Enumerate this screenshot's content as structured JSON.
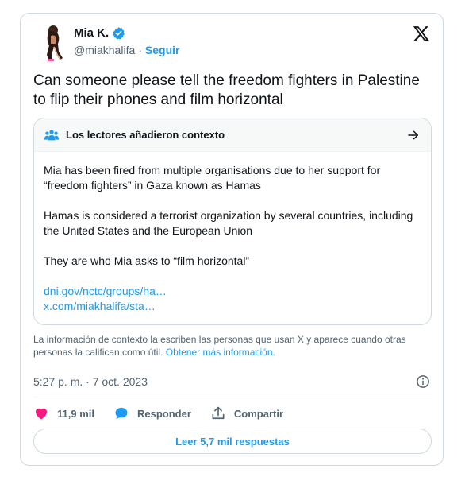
{
  "author": {
    "name": "Mia K.",
    "handle": "@miakhalifa",
    "separator": "·",
    "follow_label": "Seguir"
  },
  "tweet": {
    "text": "Can someone please tell the freedom fighters in Palestine to flip their phones and film horizontal"
  },
  "community_notes": {
    "title": "Los lectores añadieron contexto",
    "paragraphs": [
      "Mia has been fired from multiple organisations due to her support for “freedom fighters” in Gaza known as Hamas",
      "Hamas is considered a terrorist organization by several countries, including the United States and the European Union",
      "They are who Mia asks to “film horizontal”"
    ],
    "links": [
      "dni.gov/nctc/groups/ha…",
      "x.com/miakhalifa/sta…"
    ]
  },
  "disclaimer": {
    "text": "La información de contexto la escriben las personas que usan X y aparece cuando otras personas la califican como útil.",
    "more_link": "Obtener más información."
  },
  "timestamp": "5:27 p. m. · 7 oct. 2023",
  "actions": {
    "likes": "11,9 mil",
    "reply_label": "Responder",
    "share_label": "Compartir"
  },
  "read_replies_label": "Leer 5,7 mil respuestas",
  "colors": {
    "accent": "#1d9bf0",
    "like": "#f91880",
    "text_primary": "#0f1419",
    "text_secondary": "#536471",
    "border": "#cfd9de"
  },
  "icons": {
    "verified": "verified-badge-icon",
    "x_logo": "x-logo-icon",
    "notes": "community-notes-icon",
    "arrow": "arrow-right-icon",
    "info": "info-icon",
    "like": "heart-icon",
    "reply": "speech-bubble-icon",
    "share": "share-icon"
  }
}
